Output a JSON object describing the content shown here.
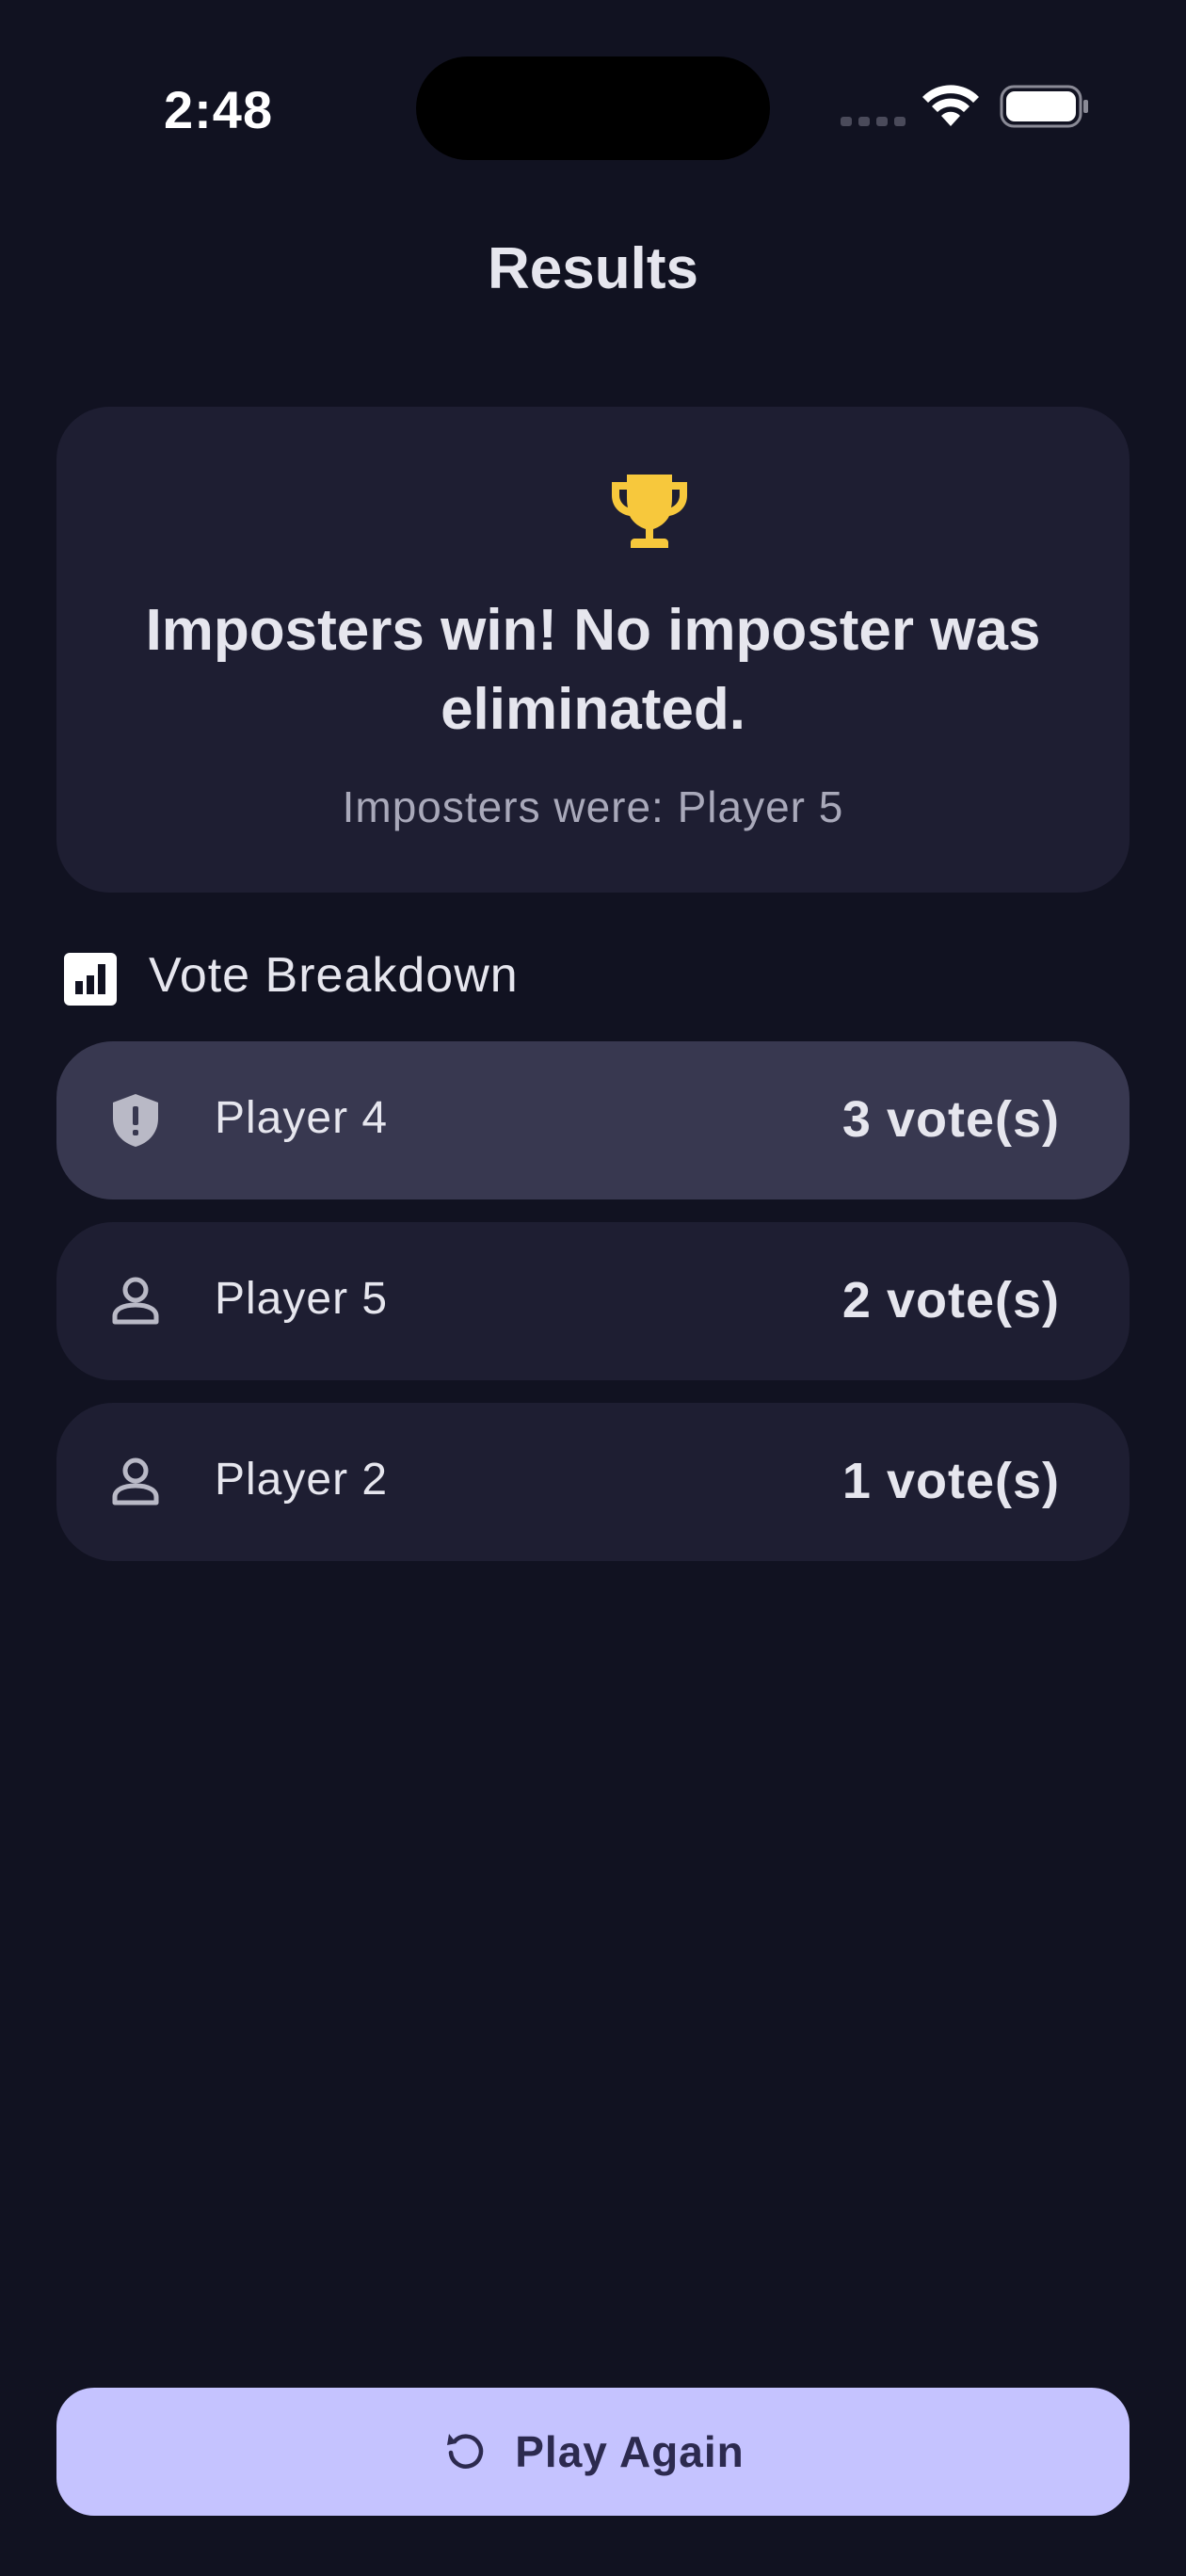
{
  "status_bar": {
    "time": "2:48",
    "icons": [
      "signal-icon",
      "wifi-icon",
      "battery-icon"
    ]
  },
  "header": {
    "title": "Results"
  },
  "result_card": {
    "icon": "trophy-icon",
    "icon_color": "#f7c83c",
    "headline": "Imposters win! No imposter was eliminated.",
    "subtitle": "Imposters were: Player 5"
  },
  "vote_breakdown": {
    "icon": "bar-chart-icon",
    "title": "Vote Breakdown",
    "rows": [
      {
        "icon": "shield-alert-icon",
        "name": "Player 4",
        "votes": "3 vote(s)",
        "highlighted": true
      },
      {
        "icon": "person-icon",
        "name": "Player 5",
        "votes": "2 vote(s)",
        "highlighted": false
      },
      {
        "icon": "person-icon",
        "name": "Player 2",
        "votes": "1 vote(s)",
        "highlighted": false
      }
    ]
  },
  "footer": {
    "play_again_icon": "replay-icon",
    "play_again_label": "Play Again"
  },
  "colors": {
    "background": "#111221",
    "card": "#1e1e32",
    "card_highlight": "#383850",
    "accent_button": "#c5c3ff",
    "button_text": "#2c2a4f"
  }
}
